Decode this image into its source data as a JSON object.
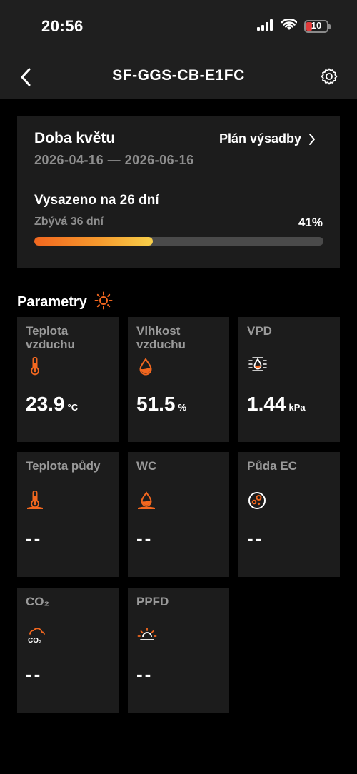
{
  "status_bar": {
    "time": "20:56",
    "battery": "10"
  },
  "header": {
    "title": "SF-GGS-CB-E1FC"
  },
  "bloom": {
    "title": "Doba květu",
    "plan_link": "Plán výsadby",
    "date_range": "2026-04-16 — 2026-06-16",
    "planted": "Vysazeno na 26 dní",
    "remaining": "Zbývá 36 dní",
    "percent": "41%",
    "progress_fraction": 0.41
  },
  "params": {
    "title": "Parametry",
    "tiles": [
      {
        "label": "Teplota vzduchu",
        "value": "23.9",
        "unit": "°C",
        "icon": "thermometer-icon"
      },
      {
        "label": "Vlhkost vzduchu",
        "value": "51.5",
        "unit": "%",
        "icon": "water-drop-icon"
      },
      {
        "label": "VPD",
        "value": "1.44",
        "unit": "kPa",
        "icon": "vpd-icon"
      },
      {
        "label": "Teplota půdy",
        "value": "--",
        "unit": "",
        "icon": "soil-thermometer-icon"
      },
      {
        "label": "WC",
        "value": "--",
        "unit": "",
        "icon": "soil-moisture-icon"
      },
      {
        "label": "Půda EC",
        "value": "--",
        "unit": "",
        "icon": "soil-ec-icon"
      },
      {
        "label": "CO₂",
        "value": "--",
        "unit": "",
        "icon": "co2-icon"
      },
      {
        "label": "PPFD",
        "value": "--",
        "unit": "",
        "icon": "sunrise-icon"
      }
    ]
  },
  "colors": {
    "accent": "#f2671f",
    "card": "#1c1c1c",
    "header_bg": "#1f1f1f",
    "muted_text": "#8e8e8e"
  }
}
